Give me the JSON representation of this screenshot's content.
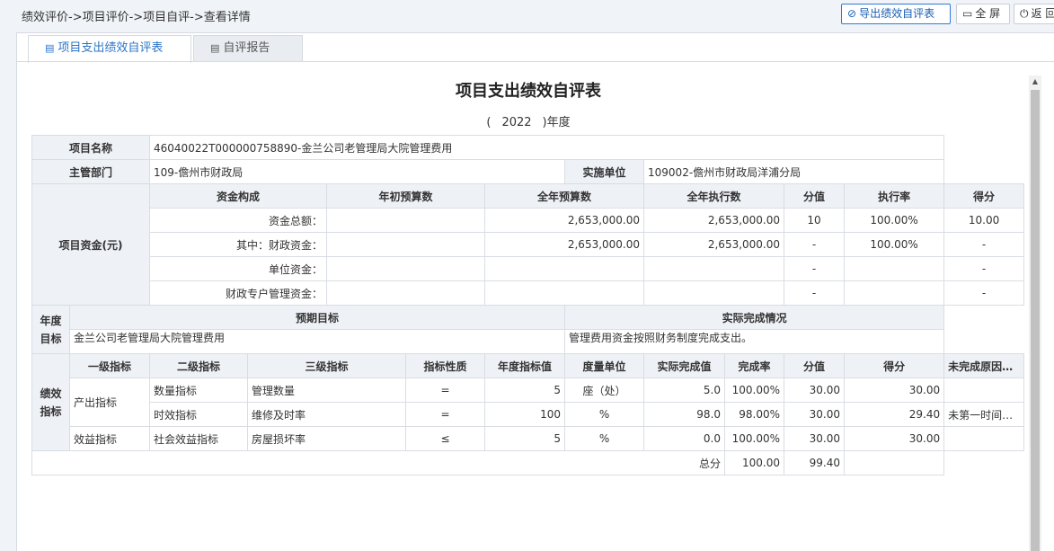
{
  "breadcrumb": "绩效评价->项目评价->项目自评->查看详情",
  "toolbar": {
    "export_label": "导出绩效自评表",
    "fullscreen_label": "全 屏",
    "back_label": "返 回"
  },
  "tabs": [
    {
      "label": "项目支出绩效自评表"
    },
    {
      "label": "自评报告"
    }
  ],
  "sheet": {
    "title": "项目支出绩效自评表",
    "year_open": "(",
    "year": "2022",
    "year_close": ")年度",
    "project_name_label": "项目名称",
    "project_name": "46040022T000000758890-金兰公司老管理局大院管理费用",
    "dept_label": "主管部门",
    "dept": "109-儋州市财政局",
    "impl_label": "实施单位",
    "impl": "109002-儋州市财政局洋浦分局",
    "funds_label": "项目资金(元)",
    "funds_headers": [
      "资金构成",
      "年初预算数",
      "全年预算数",
      "全年执行数",
      "分值",
      "执行率",
      "得分"
    ],
    "funds_rows": [
      [
        "资金总额：",
        "",
        "2,653,000.00",
        "2,653,000.00",
        "10",
        "100.00%",
        "10.00"
      ],
      [
        "其中：财政资金：",
        "",
        "2,653,000.00",
        "2,653,000.00",
        "-",
        "100.00%",
        "-"
      ],
      [
        "单位资金：",
        "",
        "",
        "",
        "-",
        "",
        "-"
      ],
      [
        "财政专户管理资金：",
        "",
        "",
        "",
        "-",
        "",
        "-"
      ]
    ],
    "goal_label_1": "年度",
    "goal_label_2": "目标",
    "goal_headers": [
      "预期目标",
      "实际完成情况"
    ],
    "goal_expected": "金兰公司老管理局大院管理费用",
    "goal_actual": "管理费用资金按照财务制度完成支出。",
    "ind_label_1": "绩效",
    "ind_label_2": "指标",
    "ind_headers": [
      "一级指标",
      "二级指标",
      "三级指标",
      "指标性质",
      "年度指标值",
      "度量单位",
      "实际完成值",
      "完成率",
      "分值",
      "得分",
      "未完成原因分析"
    ],
    "ind_rows": [
      [
        "产出指标",
        "数量指标",
        "管理数量",
        "=",
        "5",
        "座（处）",
        "5.0",
        "100.00%",
        "30.00",
        "30.00",
        ""
      ],
      [
        "",
        "时效指标",
        "维修及时率",
        "=",
        "100",
        "%",
        "98.0",
        "98.00%",
        "30.00",
        "29.40",
        "未第一时间到..."
      ],
      [
        "效益指标",
        "社会效益指标",
        "房屋损坏率",
        "≤",
        "5",
        "%",
        "0.0",
        "100.00%",
        "30.00",
        "30.00",
        ""
      ]
    ],
    "total_label": "总分",
    "total_score": "100.00",
    "total_got": "99.40"
  }
}
